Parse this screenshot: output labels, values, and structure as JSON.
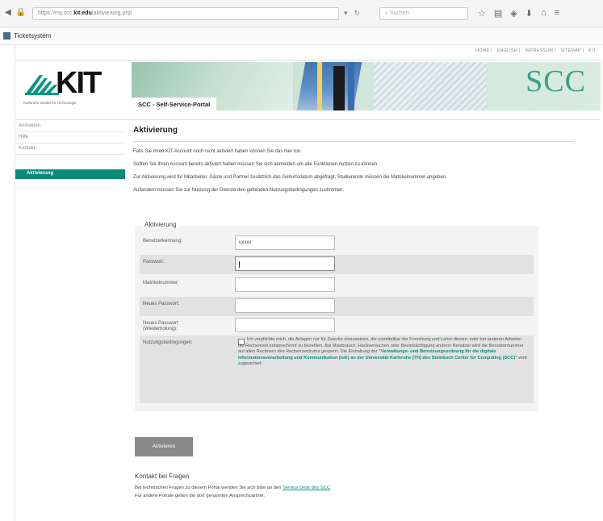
{
  "browser": {
    "url_prefix": "https://my.scc.",
    "url_domain": "kit.edu",
    "url_path": "/aktivierung.php",
    "search_placeholder": "Suchen",
    "bookmark_label": "Ticketsystem"
  },
  "header": {
    "top_links": [
      "HOME",
      "ENGLISH",
      "IMPRESSUM",
      "SITEMAP",
      "KIT"
    ],
    "logo_text": "KIT",
    "logo_subtitle": "Karlsruhe Institut für Technologie",
    "banner_text": "SCC",
    "portal_tab": "SCC - Self-Service-Portal"
  },
  "sidebar": {
    "items": [
      "Anmelden",
      "Hilfe",
      "Kontakt"
    ],
    "active_item": "Aktivierung"
  },
  "main": {
    "title": "Aktivierung",
    "paragraphs": [
      "Falls Sie Ihren KIT-Account noch nicht aktiviert haben können Sie das hier tun.",
      "Sollten Sie Ihren Account bereits aktiviert haben müssen Sie sich anmelden um alle Funktionen nutzen zu können.",
      "Zur Aktivierung wird für Mitarbeiter, Gäste und Partner zusätzlich das Geburtsdatum abgefragt, Studierende müssen die Matrikelnummer angeben.",
      "Außerdem müssen Sie zur Nutzung der Dienste den geltenden Nutzungsbedingungen zustimmen."
    ]
  },
  "form": {
    "legend": "Aktivierung",
    "username_label": "Benutzerkennung:",
    "username_value": "uxxxx",
    "password_label": "Passwort:",
    "matrikel_label": "Matrikelnummer:",
    "new_password_label": "Neues Passwort:",
    "new_password_repeat_label_1": "Neues Passwort",
    "new_password_repeat_label_2": "(Wiederholung):",
    "terms_label": "Nutzungsbedingungen:",
    "terms_text_1": "Ich verpflichte mich, die Anlagen nur für Zwecke einzusetzen, die unmittelbar der Forschung und Lehre dienen, oder bei anderen Arbeiten die Rechenzeit entsprechend zu bezahlen. Bei Missbrauch, Hackversuchen oder Beeinträchtigung anderer Benutzer wird die Benutzernummer auf allen Rechnern des Rechenzentrums gesperrt. Die Einhaltung der ",
    "terms_link": "\"Verwaltungs- und Benutzungsordnung für die digitale Informationsverarbeitung und Kommunikation (IuK) an der Universität Karlsruhe (TH) des Steinbuch Center for Computing (SCC)\"",
    "terms_text_2": " wird zugesichert.",
    "submit_label": "Aktivieren"
  },
  "contact": {
    "title": "Kontakt bei Fragen",
    "line1_text": "Bei technischen Fragen zu diesem Portal wenden Sie sich bitte an den ",
    "line1_link": "Service Desk des SCC",
    "line1_end": ".",
    "line2_text": "Für andere Portale gelten die dort genannten Ansprechpartner."
  }
}
